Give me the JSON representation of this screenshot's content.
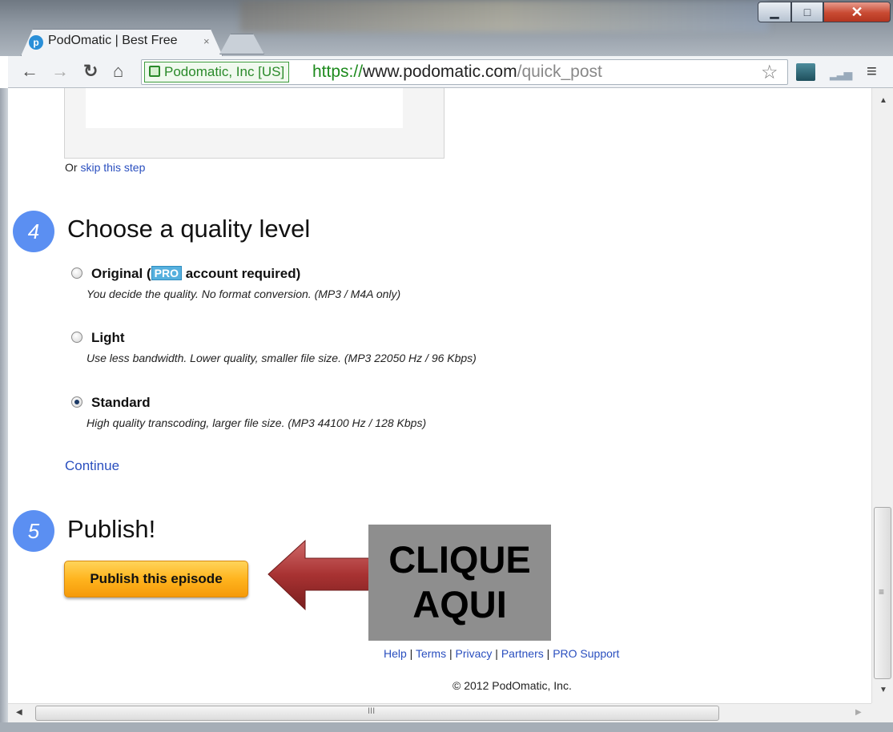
{
  "browser": {
    "tab_title": "PodOmatic | Best Free",
    "tab_close": "×",
    "ev_label": "Podomatic, Inc [US]",
    "url_scheme": "https://",
    "url_host": "www.podomatic.com",
    "url_path": "/quick_post",
    "icons": [
      "back-icon",
      "forward-icon",
      "reload-icon",
      "home-icon",
      "lock-icon",
      "star-icon",
      "menu-icon"
    ]
  },
  "upload": {
    "skip_prefix": "Or ",
    "skip_link": "skip this step"
  },
  "step4": {
    "number": "4",
    "heading": "Choose a quality level",
    "options": [
      {
        "label_before": "Original (",
        "badge": "PRO",
        "label_after": " account required)",
        "description": "You decide the quality. No format conversion. (MP3 / M4A only)",
        "selected": false
      },
      {
        "label": "Light",
        "description": "Use less bandwidth. Lower quality, smaller file size. (MP3 22050 Hz / 96 Kbps)",
        "selected": false
      },
      {
        "label": "Standard",
        "description": "High quality transcoding, larger file size. (MP3 44100 Hz / 128 Kbps)",
        "selected": true
      }
    ],
    "continue": "Continue"
  },
  "step5": {
    "number": "5",
    "heading": "Publish!",
    "button": "Publish this episode"
  },
  "annotation": {
    "line1": "CLIQUE",
    "line2": "AQUI"
  },
  "footer": {
    "links": [
      "Help",
      "Terms",
      "Privacy",
      "Partners",
      "PRO Support"
    ],
    "separator": " | ",
    "copyright": "© 2012 PodOmatic, Inc."
  },
  "colors": {
    "step_circle": "#5b8ff2",
    "link": "#2a4fbf",
    "publish_button": "#ffb41e",
    "arrow": "#b03a3a",
    "callout_bg": "#8e8e8e"
  }
}
